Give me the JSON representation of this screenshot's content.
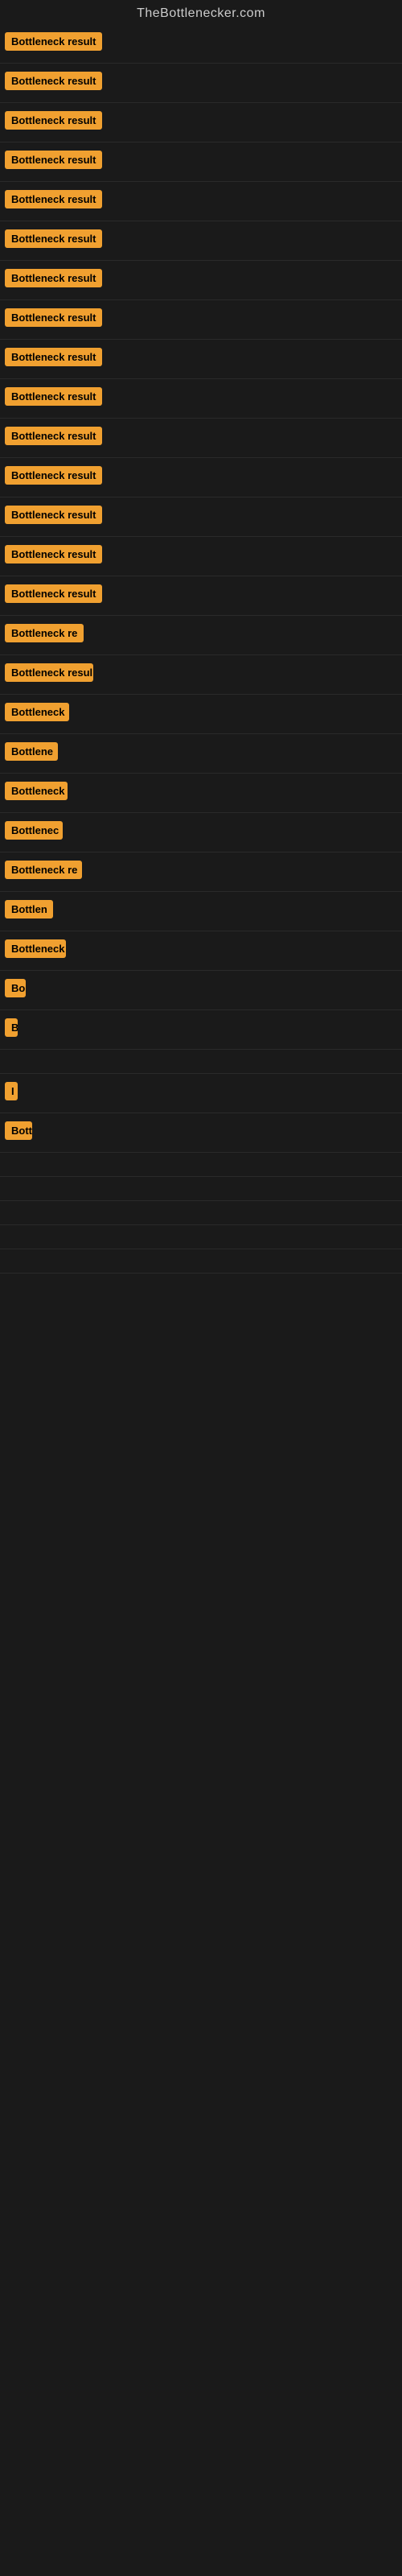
{
  "site": {
    "title": "TheBottlenecker.com"
  },
  "rows": [
    {
      "label": "Bottleneck result",
      "width": 130
    },
    {
      "label": "Bottleneck result",
      "width": 130
    },
    {
      "label": "Bottleneck result",
      "width": 130
    },
    {
      "label": "Bottleneck result",
      "width": 128
    },
    {
      "label": "Bottleneck result",
      "width": 130
    },
    {
      "label": "Bottleneck result",
      "width": 128
    },
    {
      "label": "Bottleneck result",
      "width": 128
    },
    {
      "label": "Bottleneck result",
      "width": 128
    },
    {
      "label": "Bottleneck result",
      "width": 126
    },
    {
      "label": "Bottleneck result",
      "width": 126
    },
    {
      "label": "Bottleneck result",
      "width": 126
    },
    {
      "label": "Bottleneck result",
      "width": 124
    },
    {
      "label": "Bottleneck result",
      "width": 124
    },
    {
      "label": "Bottleneck result",
      "width": 122
    },
    {
      "label": "Bottleneck result",
      "width": 122
    },
    {
      "label": "Bottleneck re",
      "width": 100
    },
    {
      "label": "Bottleneck resul",
      "width": 110
    },
    {
      "label": "Bottleneck",
      "width": 80
    },
    {
      "label": "Bottlene",
      "width": 66
    },
    {
      "label": "Bottleneck",
      "width": 78
    },
    {
      "label": "Bottlenec",
      "width": 72
    },
    {
      "label": "Bottleneck re",
      "width": 96
    },
    {
      "label": "Bottlen",
      "width": 60
    },
    {
      "label": "Bottleneck",
      "width": 76
    },
    {
      "label": "Bo",
      "width": 26
    },
    {
      "label": "B",
      "width": 14
    },
    {
      "label": "",
      "width": 10
    },
    {
      "label": "I",
      "width": 8
    },
    {
      "label": "Bott",
      "width": 34
    },
    {
      "label": "",
      "width": 0
    },
    {
      "label": "",
      "width": 0
    },
    {
      "label": "",
      "width": 0
    },
    {
      "label": "",
      "width": 0
    },
    {
      "label": "",
      "width": 0
    }
  ]
}
